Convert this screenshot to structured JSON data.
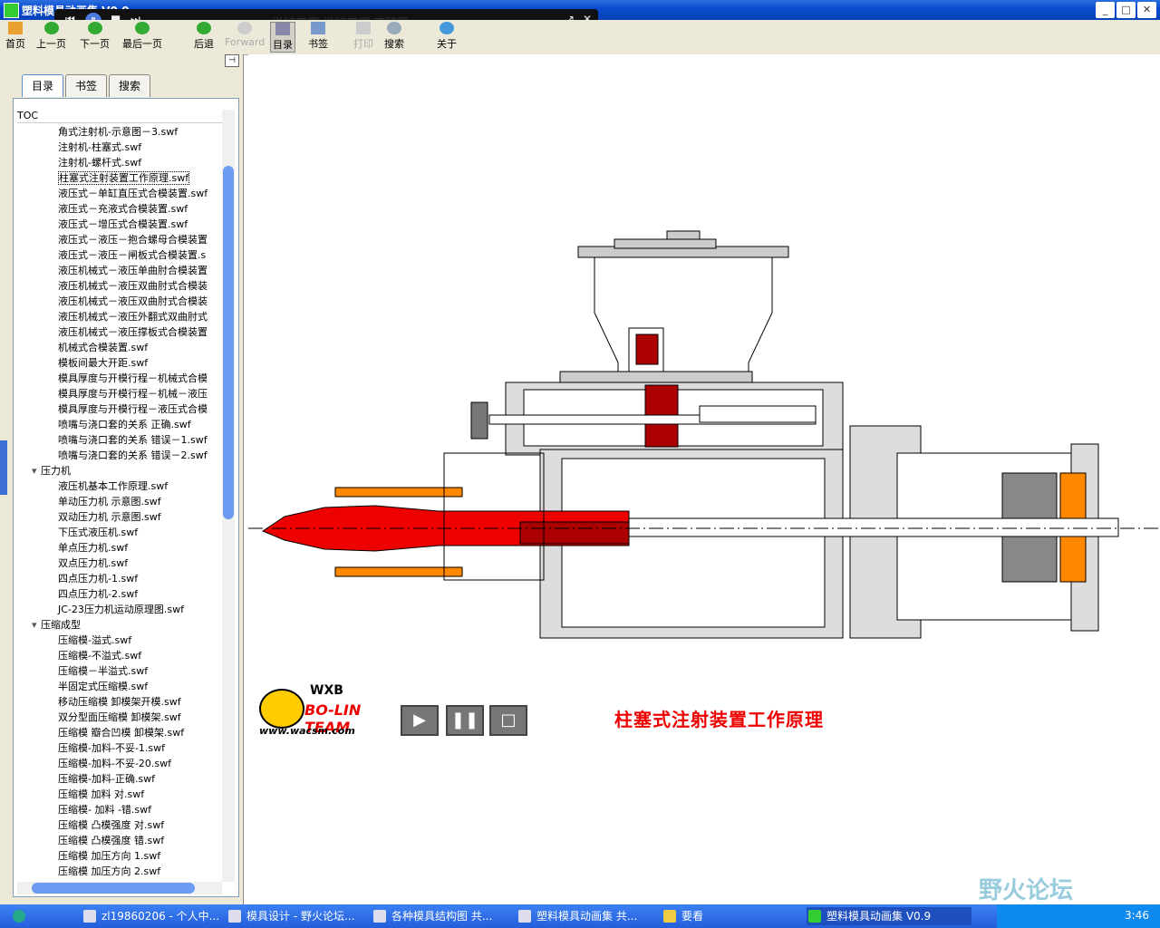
{
  "window": {
    "title": "塑料模具动画集 V0.9"
  },
  "media_player": {
    "song": "说好不哭  说好不哭  不顽固"
  },
  "toolbar": {
    "home": "首页",
    "prev": "上一页",
    "next": "下一页",
    "last": "最后一页",
    "back": "后退",
    "forward": "Forward",
    "toc": "目录",
    "bookmark": "书签",
    "print": "打印",
    "search": "搜索",
    "about": "关于"
  },
  "sidebar": {
    "tabs": [
      "目录",
      "书签",
      "搜索"
    ],
    "toc_header": "TOC",
    "items": [
      {
        "label": "角式注射机-示意图－3.swf",
        "level": 2
      },
      {
        "label": "注射机-柱塞式.swf",
        "level": 2
      },
      {
        "label": "注射机-螺杆式.swf",
        "level": 2
      },
      {
        "label": "柱塞式注射装置工作原理.swf",
        "level": 2,
        "selected": true
      },
      {
        "label": "液压式－单缸直压式合模装置.swf",
        "level": 2
      },
      {
        "label": "液压式－充液式合模装置.swf",
        "level": 2
      },
      {
        "label": "液压式－增压式合模装置.swf",
        "level": 2
      },
      {
        "label": "液压式－液压－抱合螺母合模装置",
        "level": 2
      },
      {
        "label": "液压式－液压－闸板式合模装置.s",
        "level": 2
      },
      {
        "label": "液压机械式－液压单曲肘合模装置",
        "level": 2
      },
      {
        "label": "液压机械式－液压双曲肘式合模装",
        "level": 2
      },
      {
        "label": "液压机械式－液压双曲肘式合模装",
        "level": 2
      },
      {
        "label": "液压机械式－液压外翻式双曲肘式",
        "level": 2
      },
      {
        "label": "液压机械式－液压撑板式合模装置",
        "level": 2
      },
      {
        "label": "机械式合模装置.swf",
        "level": 2
      },
      {
        "label": "模板间最大开距.swf",
        "level": 2
      },
      {
        "label": "模具厚度与开模行程－机械式合模",
        "level": 2
      },
      {
        "label": "模具厚度与开模行程－机械－液压",
        "level": 2
      },
      {
        "label": "模具厚度与开模行程－液压式合模",
        "level": 2
      },
      {
        "label": "喷嘴与浇口套的关系 正确.swf",
        "level": 2
      },
      {
        "label": "喷嘴与浇口套的关系 错误－1.swf",
        "level": 2
      },
      {
        "label": "喷嘴与浇口套的关系 错误－2.swf",
        "level": 2
      },
      {
        "label": "压力机",
        "level": 1
      },
      {
        "label": "液压机基本工作原理.swf",
        "level": 2
      },
      {
        "label": "单动压力机 示意图.swf",
        "level": 2
      },
      {
        "label": "双动压力机 示意图.swf",
        "level": 2
      },
      {
        "label": "下压式液压机.swf",
        "level": 2
      },
      {
        "label": "单点压力机.swf",
        "level": 2
      },
      {
        "label": "双点压力机.swf",
        "level": 2
      },
      {
        "label": "四点压力机-1.swf",
        "level": 2
      },
      {
        "label": "四点压力机-2.swf",
        "level": 2
      },
      {
        "label": "JC-23压力机运动原理图.swf",
        "level": 2
      },
      {
        "label": "压缩成型",
        "level": 1
      },
      {
        "label": "压缩模-溢式.swf",
        "level": 2
      },
      {
        "label": "压缩模-不溢式.swf",
        "level": 2
      },
      {
        "label": "压缩模－半溢式.swf",
        "level": 2
      },
      {
        "label": "半固定式压缩模.swf",
        "level": 2
      },
      {
        "label": "移动压缩模 卸模架开模.swf",
        "level": 2
      },
      {
        "label": "双分型面压缩模 卸模架.swf",
        "level": 2
      },
      {
        "label": "压缩模 瓣合凹模 卸模架.swf",
        "level": 2
      },
      {
        "label": "压缩模-加料-不妥-1.swf",
        "level": 2
      },
      {
        "label": "压缩模-加料-不妥-20.swf",
        "level": 2
      },
      {
        "label": "压缩模-加料-正确.swf",
        "level": 2
      },
      {
        "label": "压缩模 加料 对.swf",
        "level": 2
      },
      {
        "label": "压缩模- 加料 -错.swf",
        "level": 2
      },
      {
        "label": "压缩模 凸模强度 对.swf",
        "level": 2
      },
      {
        "label": "压缩模 凸模强度 错.swf",
        "level": 2
      },
      {
        "label": "压缩模 加压方向 1.swf",
        "level": 2
      },
      {
        "label": "压缩模 加压方向 2.swf",
        "level": 2
      }
    ]
  },
  "content": {
    "logo": {
      "wxb": "WXB",
      "team": "BO-LIN TEAM",
      "url": "www.wacsm.com"
    },
    "caption": "柱塞式注射装置工作原理",
    "watermark": "野火论坛"
  },
  "taskbar": {
    "items": [
      "zl19860206 - 个人中...",
      "模具设计 - 野火论坛...",
      "各种模具结构图 共...",
      "塑料模具动画集 共...",
      "要看",
      "塑料模具动画集 V0.9"
    ],
    "clock": "3:46"
  }
}
